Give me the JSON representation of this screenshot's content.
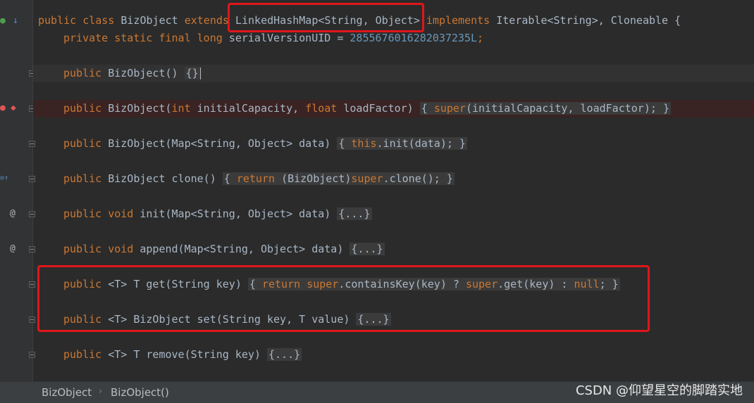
{
  "code_lines": {
    "l1": {
      "a": "public class ",
      "b": "BizObject ",
      "c": "extends ",
      "d": "LinkedHashMap<String, Object> ",
      "e": "implements ",
      "f": "Iterable<String>, Cloneable {"
    },
    "l2": {
      "a": "private static final long ",
      "b": "serialVersionUID = ",
      "c": "2855676016282037235L",
      "d": ";"
    },
    "l3": {
      "a": "public ",
      "b": "BizObject() ",
      "c": "{}"
    },
    "l4": {
      "a": "public ",
      "b": "BizObject(",
      "c": "int ",
      "d": "initialCapacity, ",
      "e": "float ",
      "f": "loadFactor) ",
      "g": "{ ",
      "h": "super",
      "i": "(initialCapacity, loadFactor); ",
      "j": "}"
    },
    "l5": {
      "a": "public ",
      "b": "BizObject(Map<String, Object> data) ",
      "c": "{ ",
      "d": "this",
      "e": ".init(data); ",
      "f": "}"
    },
    "l6": {
      "a": "public ",
      "b": "BizObject clone() ",
      "c": "{ ",
      "d": "return ",
      "e": "(BizObject)",
      "f": "super",
      "g": ".clone(); ",
      "h": "}"
    },
    "l7": {
      "a": "public void ",
      "b": "init(Map<String, Object> data) ",
      "c": "{...}"
    },
    "l8": {
      "a": "public void ",
      "b": "append(Map<String, Object> data) ",
      "c": "{...}"
    },
    "l9": {
      "a": "public ",
      "b": "<T> T get(String key) ",
      "c": "{ ",
      "d": "return ",
      "e": "super",
      "f": ".containsKey(key) ? ",
      "g": "super",
      "h": ".get(key) : ",
      "i": "null",
      "j": "; }"
    },
    "l10": {
      "a": "public ",
      "b": "<T> BizObject set(String key, T value) ",
      "c": "{...}"
    },
    "l11": {
      "a": "public ",
      "b": "<T> T remove(String key) ",
      "c": "{...}"
    }
  },
  "gutter_icons": {
    "run": "●",
    "override": "↓",
    "breakpoint": "●",
    "diamond": "◆",
    "at1": "@",
    "at2": "@",
    "implements": "⊙↑"
  },
  "breadcrumb": {
    "item1": "BizObject",
    "sep": "›",
    "item2": "BizObject()"
  },
  "watermark": "CSDN @仰望星空的脚踏实地",
  "colors": {
    "keyword": "#cc7832",
    "number": "#6897bb",
    "text": "#a9b7c6",
    "annotation_box": "#e0161b"
  }
}
